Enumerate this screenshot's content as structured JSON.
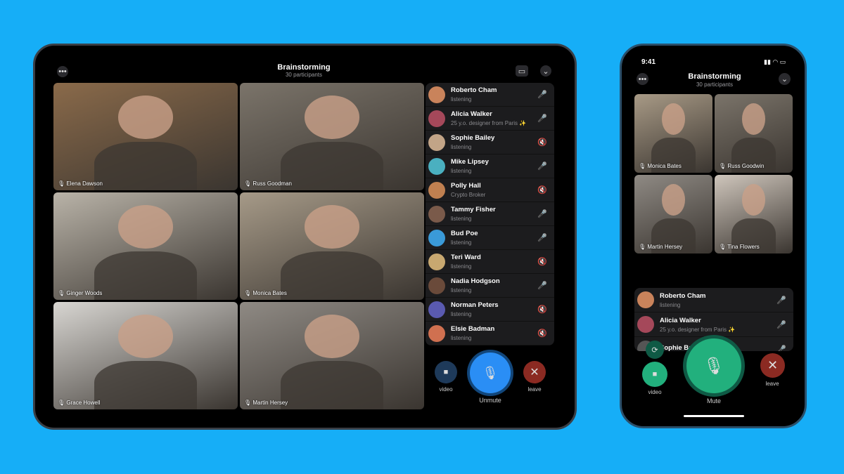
{
  "colors": {
    "background": "#16aef7",
    "unmute": "#2a8ef5",
    "mute": "#22b07d",
    "leave": "#8b2a22"
  },
  "tablet": {
    "title": "Brainstorming",
    "subtitle": "30 participants",
    "tiles": [
      {
        "name": "Elena Dawson",
        "bg": "#8a6a4a"
      },
      {
        "name": "Russ Goodman",
        "bg": "#7b746a"
      },
      {
        "name": "Ginger Woods",
        "bg": "#b9b3a8"
      },
      {
        "name": "Monica Bates",
        "bg": "#a69a88"
      },
      {
        "name": "Grace Howell",
        "bg": "#d8d6d2"
      },
      {
        "name": "Martin Hersey",
        "bg": "#8f8a84"
      }
    ],
    "participants": [
      {
        "name": "Roberto Cham",
        "status": "listening",
        "muted": false,
        "color": "#c9835b"
      },
      {
        "name": "Alicia Walker",
        "status": "25 y.o. designer from Paris ✨",
        "muted": false,
        "color": "#a5485a"
      },
      {
        "name": "Sophie Bailey",
        "status": "listening",
        "muted": true,
        "color": "#c2a487"
      },
      {
        "name": "Mike Lipsey",
        "status": "listening",
        "muted": false,
        "color": "#4ab0c0"
      },
      {
        "name": "Polly Hall",
        "status": "Crypto Broker",
        "muted": true,
        "color": "#c08050"
      },
      {
        "name": "Tammy Fisher",
        "status": "listening",
        "muted": false,
        "color": "#7a5a4a"
      },
      {
        "name": "Bud Poe",
        "status": "listening",
        "muted": false,
        "color": "#3a9ad8"
      },
      {
        "name": "Teri Ward",
        "status": "listening",
        "muted": true,
        "color": "#c8a870"
      },
      {
        "name": "Nadia Hodgson",
        "status": "listening",
        "muted": false,
        "color": "#6a4a3a"
      },
      {
        "name": "Norman Peters",
        "status": "listening",
        "muted": true,
        "color": "#5a5ab0"
      },
      {
        "name": "Elsie Badman",
        "status": "listening",
        "muted": true,
        "color": "#d07050"
      }
    ],
    "controls": {
      "video": "video",
      "main": "Unmute",
      "leave": "leave"
    }
  },
  "phone": {
    "time": "9:41",
    "title": "Brainstorming",
    "subtitle": "30 participants",
    "tiles": [
      {
        "name": "Monica Bates",
        "bg": "#a89a86"
      },
      {
        "name": "Russ Goodwin",
        "bg": "#7b746a"
      },
      {
        "name": "Martin Hersey",
        "bg": "#8f8a84"
      },
      {
        "name": "Tina Flowers",
        "bg": "#cfc6bc"
      }
    ],
    "participants": [
      {
        "name": "Roberto Cham",
        "status": "listening",
        "color": "#c9835b"
      },
      {
        "name": "Alicia Walker",
        "status": "25 y.o. designer from Paris ✨",
        "color": "#a5485a"
      },
      {
        "name": "Sophie Bailey",
        "status": "",
        "color": "#555"
      }
    ],
    "controls": {
      "video": "video",
      "main": "Mute",
      "leave": "leave"
    }
  }
}
